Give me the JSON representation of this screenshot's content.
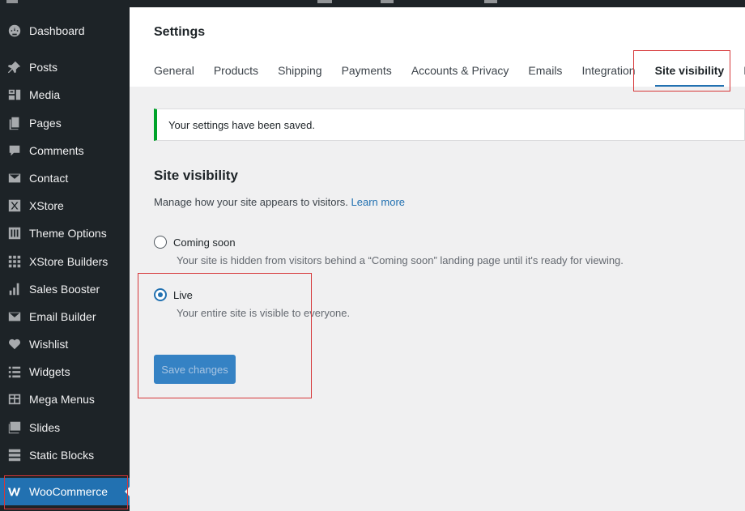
{
  "sidebar": {
    "items": [
      {
        "label": "Dashboard",
        "icon": "dashboard-icon"
      },
      {
        "label": "Posts",
        "icon": "pin-icon"
      },
      {
        "label": "Media",
        "icon": "media-icon"
      },
      {
        "label": "Pages",
        "icon": "pages-icon"
      },
      {
        "label": "Comments",
        "icon": "comment-icon"
      },
      {
        "label": "Contact",
        "icon": "mail-icon"
      },
      {
        "label": "XStore",
        "icon": "xstore-icon"
      },
      {
        "label": "Theme Options",
        "icon": "sliders-icon"
      },
      {
        "label": "XStore Builders",
        "icon": "grid-icon"
      },
      {
        "label": "Sales Booster",
        "icon": "bar-chart-icon"
      },
      {
        "label": "Email Builder",
        "icon": "envelope-icon"
      },
      {
        "label": "Wishlist",
        "icon": "heart-icon"
      },
      {
        "label": "Widgets",
        "icon": "widgets-icon"
      },
      {
        "label": "Mega Menus",
        "icon": "table-icon"
      },
      {
        "label": "Slides",
        "icon": "slides-icon"
      },
      {
        "label": "Static Blocks",
        "icon": "blocks-icon"
      },
      {
        "label": "WooCommerce",
        "icon": "woocommerce-icon",
        "current": true
      }
    ]
  },
  "header": {
    "title": "Settings",
    "tabs": [
      {
        "label": "General"
      },
      {
        "label": "Products"
      },
      {
        "label": "Shipping"
      },
      {
        "label": "Payments"
      },
      {
        "label": "Accounts & Privacy"
      },
      {
        "label": "Emails"
      },
      {
        "label": "Integration"
      },
      {
        "label": "Site visibility",
        "active": true
      },
      {
        "label": "F"
      }
    ]
  },
  "notice": {
    "text": "Your settings have been saved."
  },
  "section": {
    "title": "Site visibility",
    "description": "Manage how your site appears to visitors.",
    "learn_more": "Learn more"
  },
  "options": [
    {
      "label": "Coming soon",
      "help": "Your site is hidden from visitors behind a “Coming soon” landing page until it's ready for viewing.",
      "checked": false
    },
    {
      "label": "Live",
      "help": "Your entire site is visible to everyone.",
      "checked": true
    }
  ],
  "save_button": {
    "label": "Save changes"
  },
  "colors": {
    "accent": "#2271b1",
    "sidebar": "#1d2327",
    "success": "#00a32a",
    "annotation": "#d63638"
  }
}
